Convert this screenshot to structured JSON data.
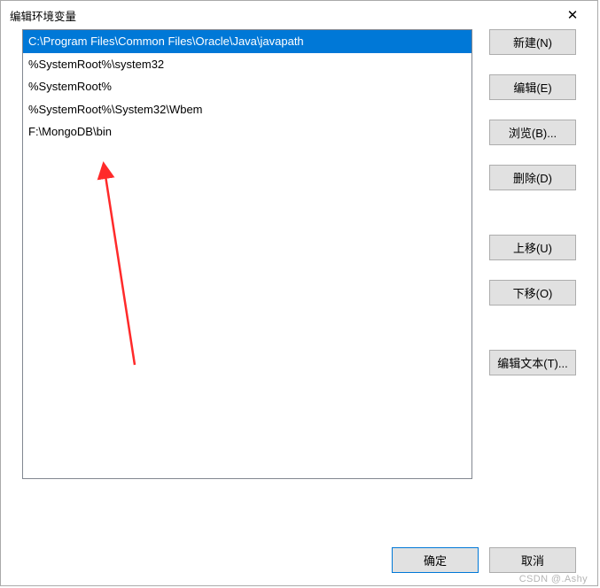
{
  "window": {
    "title": "编辑环境变量"
  },
  "envList": {
    "items": [
      "C:\\Program Files\\Common Files\\Oracle\\Java\\javapath",
      "%SystemRoot%\\system32",
      "%SystemRoot%",
      "%SystemRoot%\\System32\\Wbem",
      "F:\\MongoDB\\bin"
    ],
    "selectedIndex": 0
  },
  "buttons": {
    "new": "新建(N)",
    "edit": "编辑(E)",
    "browse": "浏览(B)...",
    "delete": "删除(D)",
    "moveUp": "上移(U)",
    "moveDown": "下移(O)",
    "editText": "编辑文本(T)...",
    "ok": "确定",
    "cancel": "取消"
  },
  "watermark": "CSDN @.Ashy"
}
